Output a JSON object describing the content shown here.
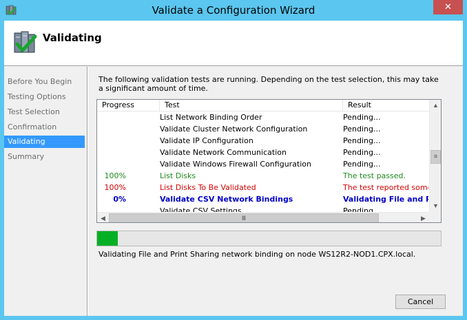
{
  "window": {
    "title": "Validate a Configuration Wizard",
    "close_glyph": "✕",
    "app_icon": "cluster-wizard-icon"
  },
  "header": {
    "title": "Validating",
    "icon": "server-checkmark-icon"
  },
  "nav": {
    "items": [
      {
        "label": "Before You Begin",
        "active": false
      },
      {
        "label": "Testing Options",
        "active": false
      },
      {
        "label": "Test Selection",
        "active": false
      },
      {
        "label": "Confirmation",
        "active": false
      },
      {
        "label": "Validating",
        "active": true
      },
      {
        "label": "Summary",
        "active": false
      }
    ]
  },
  "main": {
    "description": "The following validation tests are running. Depending on the test selection, this may take a significant amount of time.",
    "columns": [
      "Progress",
      "Test",
      "Result"
    ],
    "rows": [
      {
        "progress": "",
        "test": "List Network Binding Order",
        "result": "Pending...",
        "state": "pending"
      },
      {
        "progress": "",
        "test": "Validate Cluster Network Configuration",
        "result": "Pending...",
        "state": "pending"
      },
      {
        "progress": "",
        "test": "Validate IP Configuration",
        "result": "Pending...",
        "state": "pending"
      },
      {
        "progress": "",
        "test": "Validate Network Communication",
        "result": "Pending...",
        "state": "pending"
      },
      {
        "progress": "",
        "test": "Validate Windows Firewall Configuration",
        "result": "Pending...",
        "state": "pending"
      },
      {
        "progress": "100%",
        "test": "List Disks",
        "result": "The test passed.",
        "state": "pass"
      },
      {
        "progress": "100%",
        "test": "List Disks To Be Validated",
        "result": "The test reported some wa",
        "state": "fail"
      },
      {
        "progress": "0%",
        "test": "Validate CSV Network Bindings",
        "result": "Validating File and Prin",
        "state": "running"
      },
      {
        "progress": "",
        "test": "Validate CSV Settings",
        "result": "Pending...",
        "state": "pending"
      }
    ],
    "progress_fraction": 0.06,
    "status": "Validating File and Print Sharing network binding on node WS12R2-NOD1.CPX.local.",
    "cancel_label": "Cancel"
  },
  "scroll_glyphs": {
    "up": "▲",
    "down": "▼",
    "left": "◀",
    "right": "▶",
    "vthumb": "≡",
    "hthumb": "Ⅲ"
  },
  "colors": {
    "accent": "#3399ff",
    "titlebar": "#5bc6ef",
    "close": "#c75050",
    "progress": "#06b025",
    "pass": "#1e8a1e",
    "fail": "#d40000",
    "running": "#0000c8"
  }
}
